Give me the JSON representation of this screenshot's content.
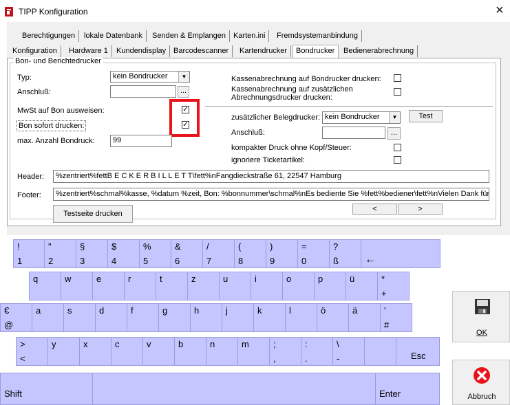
{
  "window": {
    "title": "TIPP Konfiguration",
    "close": "✕"
  },
  "tabs_row1": [
    "Berechtigungen",
    "lokale Datenbank",
    "Senden & Emplangen",
    "Karten.ini",
    "Fremdsystemanbindung"
  ],
  "tabs_row2": [
    "Konfiguration",
    "Hardware 1",
    "Kundendisplay",
    "Barcodescanner",
    "Kartendrucker",
    "Bondrucker",
    "Bedienerabrechnung"
  ],
  "active_tab": "Bondrucker",
  "group_title": "Bon- und Berichtedrucker",
  "left": {
    "typ_label": "Typ:",
    "typ_value": "kein Bondrucker",
    "anschluss_label": "Anschluß:",
    "anschluss_value": "",
    "browse": "...",
    "mwst_label": "MwSt auf Bon ausweisen:",
    "mwst_checked": "✓",
    "sofort_label": "Bon sofort drucken:",
    "sofort_checked": "✓",
    "max_label": "max. Anzahl Bondruck:",
    "max_value": "99"
  },
  "right": {
    "kasse_label": "Kassenabrechnung auf Bondrucker drucken:",
    "kasse2_label_line1": "Kassenabrechnung auf zusätzlichen",
    "kasse2_label_line2": "Abrechnungsdrucker drucken:",
    "beleg_label": "zusätzlicher Belegdrucker:",
    "beleg_value": "kein Bondrucker",
    "test_button": "Test",
    "anschluss_label": "Anschluß:",
    "browse": "...",
    "kompakt_label": "kompakter Druck ohne Kopf/Steuer:",
    "ignoriere_label": "ignoriere Ticketartikel:"
  },
  "header_label": "Header:",
  "header_value": "%zentriert%fettB E C K E R B I L L E T T\\fett%nFangdieckstraße 61, 22547 Hamburg",
  "footer_label": "Footer:",
  "footer_value": "%zentriert%schmal%kasse, %datum %zeit, Bon: %bonnummer\\schmal%nEs bediente Sie %fett%bediener\\fett%nVielen Dank für Ihren",
  "nav_prev": "<",
  "nav_next": ">",
  "testseite_button": "Testseite drucken",
  "keys_row1": [
    [
      "!",
      "1"
    ],
    [
      "\"",
      "2"
    ],
    [
      "§",
      "3"
    ],
    [
      "$",
      "4"
    ],
    [
      "%",
      "5"
    ],
    [
      "&",
      "6"
    ],
    [
      "/",
      "7"
    ],
    [
      "(",
      "8"
    ],
    [
      ")",
      "9"
    ],
    [
      "=",
      "0"
    ],
    [
      "?",
      "ß"
    ],
    [
      "",
      "←"
    ]
  ],
  "keys_row2": [
    [
      "q",
      ""
    ],
    [
      "w",
      ""
    ],
    [
      "e",
      ""
    ],
    [
      "r",
      ""
    ],
    [
      "t",
      ""
    ],
    [
      "z",
      ""
    ],
    [
      "u",
      ""
    ],
    [
      "i",
      ""
    ],
    [
      "o",
      ""
    ],
    [
      "p",
      ""
    ],
    [
      "ü",
      ""
    ],
    [
      "*",
      "+"
    ]
  ],
  "keys_row3": [
    [
      "€",
      "@"
    ],
    [
      "a",
      ""
    ],
    [
      "s",
      ""
    ],
    [
      "d",
      ""
    ],
    [
      "f",
      ""
    ],
    [
      "g",
      ""
    ],
    [
      "h",
      ""
    ],
    [
      "j",
      ""
    ],
    [
      "k",
      ""
    ],
    [
      "l",
      ""
    ],
    [
      "ö",
      ""
    ],
    [
      "ä",
      ""
    ],
    [
      "'",
      "#"
    ]
  ],
  "keys_row4": [
    [
      ">",
      "<"
    ],
    [
      "y",
      ""
    ],
    [
      "x",
      ""
    ],
    [
      "c",
      ""
    ],
    [
      "v",
      ""
    ],
    [
      "b",
      ""
    ],
    [
      "n",
      ""
    ],
    [
      "m",
      ""
    ],
    [
      ";",
      ","
    ],
    [
      ":",
      "."
    ],
    [
      "\\",
      "-"
    ],
    [
      "Esc",
      ""
    ]
  ],
  "key_shift": "Shift",
  "key_enter": "Enter",
  "ok_button": "OK",
  "abbruch_button": "Abbruch"
}
